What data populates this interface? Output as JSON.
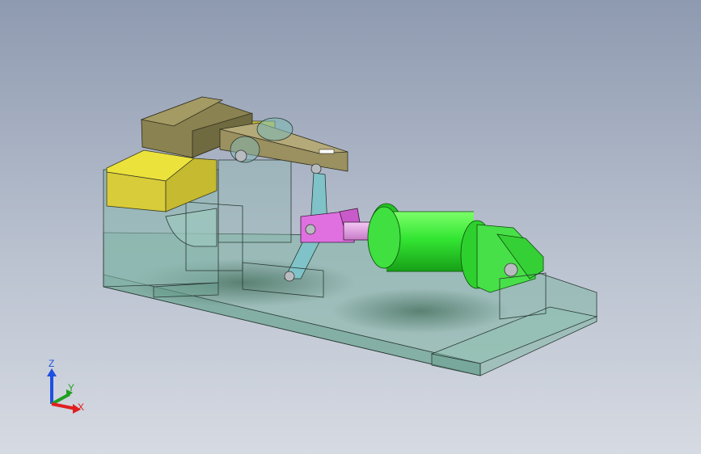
{
  "viewport": {
    "background_top": "#8e9ab0",
    "background_bottom": "#d6dae2"
  },
  "model_colors": {
    "base_plate": "#7fb5a4",
    "frame": "#87b7ad",
    "housing_block": "#d8cc3a",
    "motor_housing": "#8a8250",
    "lever_arm": "#9a9060",
    "link": "#7fc3c8",
    "clevis": "#e070e0",
    "cylinder": "#33e633"
  },
  "triad": {
    "z_label": "Z",
    "y_label": "Y",
    "x_label": "X",
    "z_color": "#2050e0",
    "y_color": "#20a020",
    "x_color": "#e02020"
  }
}
